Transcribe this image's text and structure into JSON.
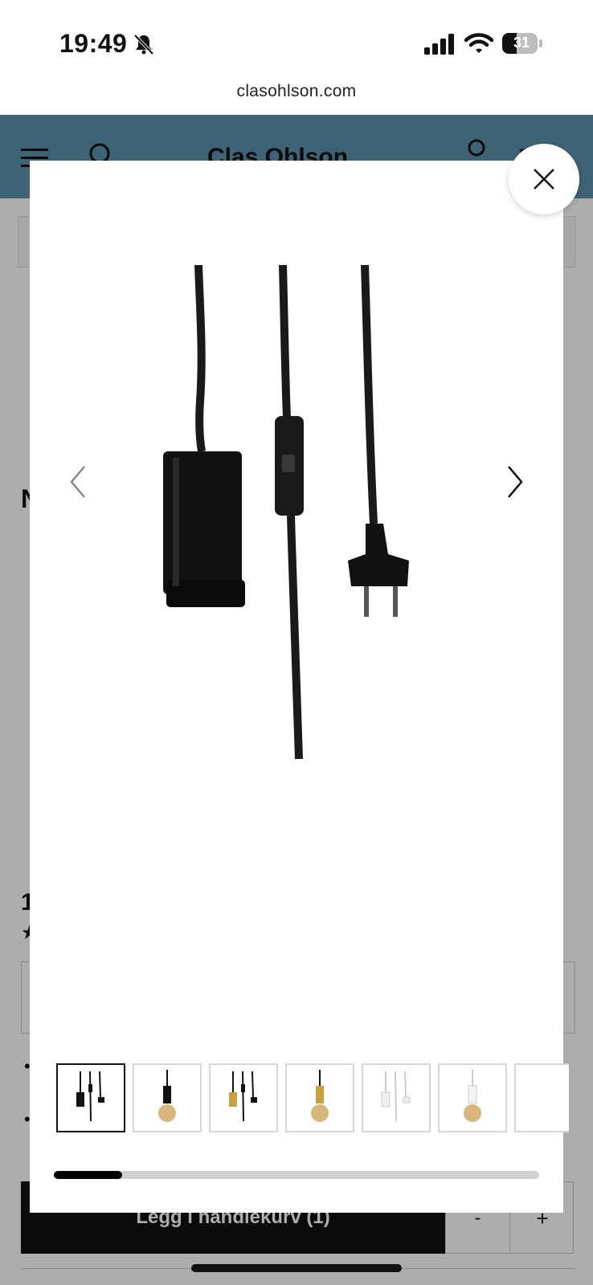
{
  "status_bar": {
    "time": "19:49",
    "battery": "31",
    "icons": [
      "bell-slash-icon",
      "cellular-signal-icon",
      "wifi-icon",
      "battery-icon"
    ]
  },
  "browser": {
    "url": "clasohlson.com"
  },
  "header": {
    "logo": "Clas Ohlson",
    "background": "#5b93ad",
    "icons": [
      "menu-icon",
      "search-icon",
      "user-icon",
      "cart-icon"
    ]
  },
  "page": {
    "title_initial": "N",
    "price_initial": "1",
    "rating_star": "★",
    "bullet": "•",
    "add_to_cart_label": "Legg i handlekurv (1)",
    "qty_minus": "-",
    "qty_plus": "+"
  },
  "gallery": {
    "image_alt": "Black pendant lamp socket with textile cord, inline switch and plug",
    "thumbnails": [
      {
        "variant": "black cord set",
        "active": true
      },
      {
        "variant": "black with bulb",
        "active": false
      },
      {
        "variant": "brass cord set",
        "active": false
      },
      {
        "variant": "brass with bulb",
        "active": false
      },
      {
        "variant": "white cord set",
        "active": false
      },
      {
        "variant": "white with bulb",
        "active": false
      },
      {
        "variant": "partially visible",
        "active": false
      }
    ],
    "scroll_progress": 0.14,
    "icons": [
      "chevron-left-icon",
      "chevron-right-icon",
      "close-icon"
    ]
  }
}
